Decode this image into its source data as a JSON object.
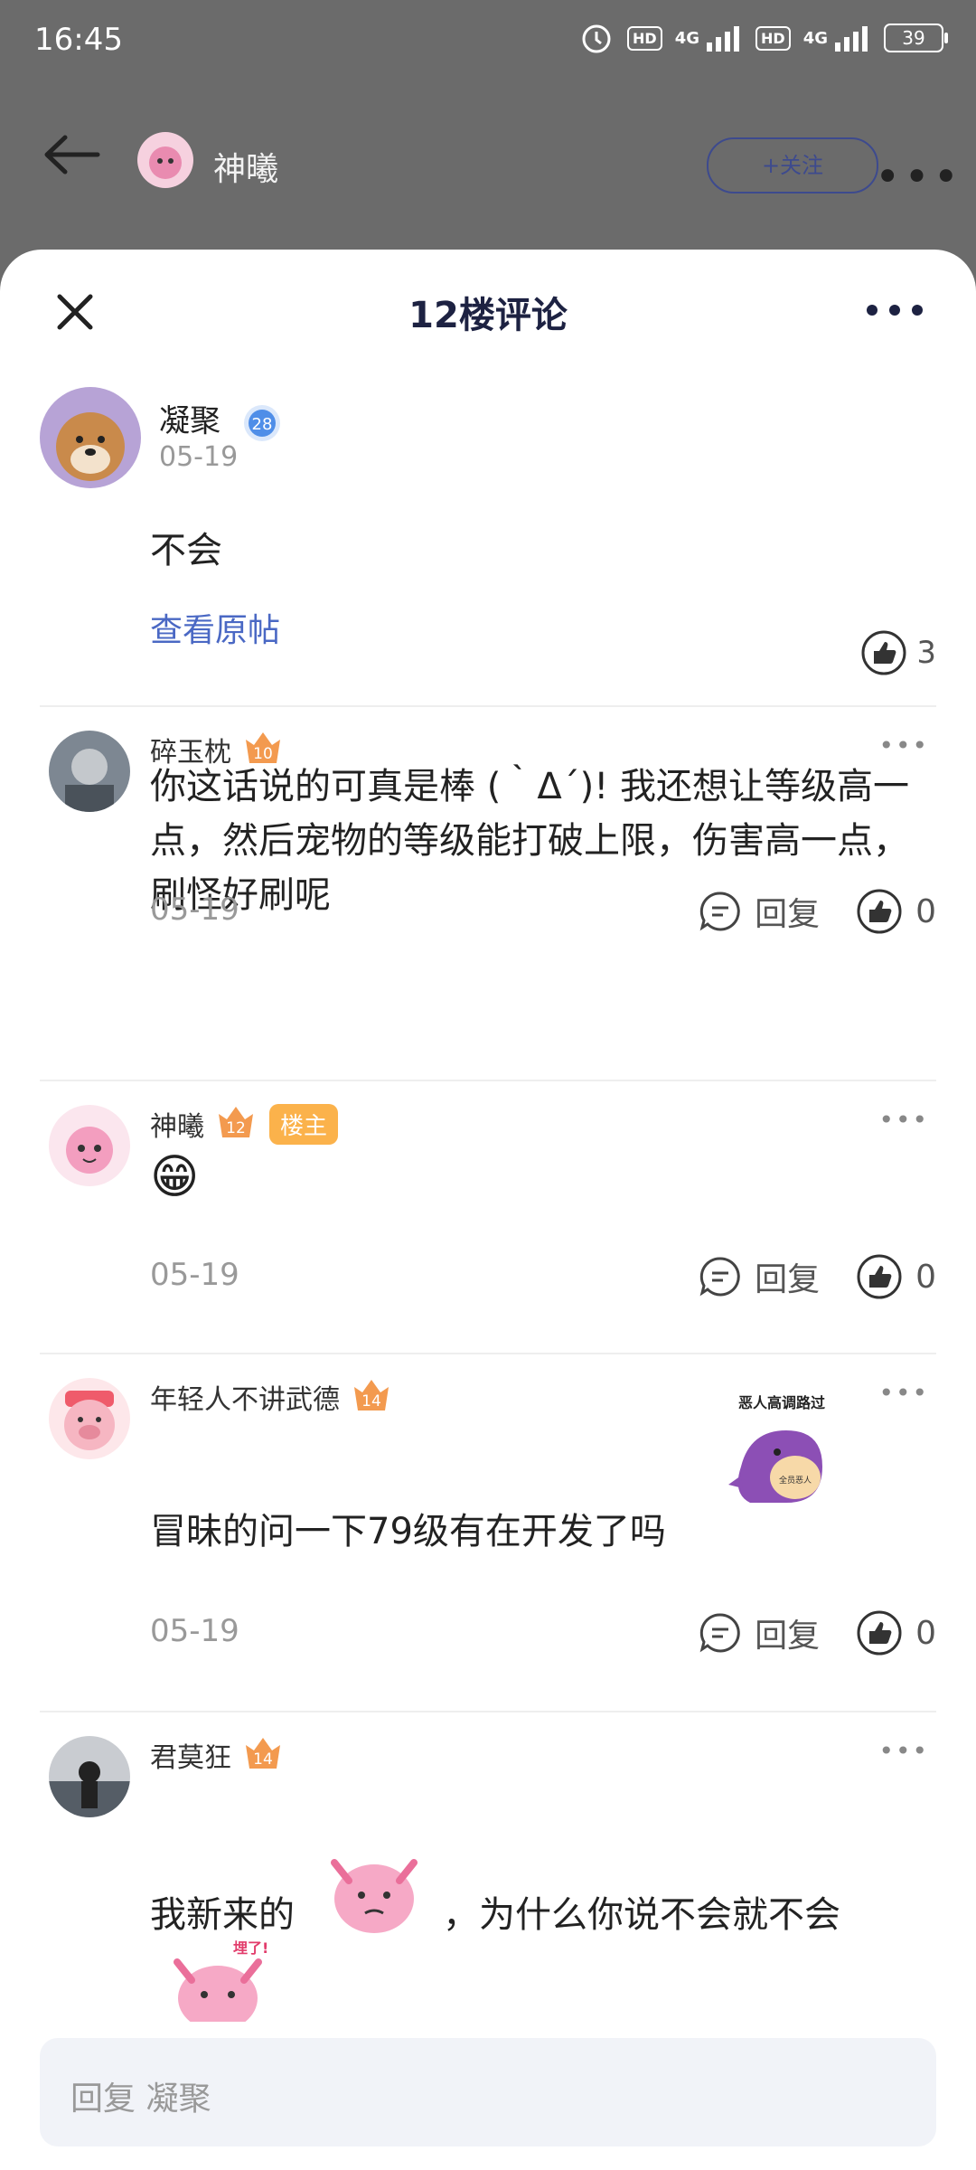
{
  "status": {
    "time": "16:45",
    "hd": "HD",
    "net": "4G",
    "battery": "39"
  },
  "topbar": {
    "name": "神曦",
    "follow": "+关注"
  },
  "sheet": {
    "title": "12楼评论"
  },
  "main_comment": {
    "user": "凝聚",
    "level": "28",
    "date": "05-19",
    "text": "不会",
    "view_post": "查看原帖",
    "likes": "3"
  },
  "replies": [
    {
      "user": "碎玉枕",
      "level": "10",
      "text": "你这话说的可真是棒 (｀Δ´)! 我还想让等级高一点，然后宠物的等级能打破上限，伤害高一点，刷怪好刷呢",
      "date": "05-19",
      "reply": "回复",
      "likes": "0"
    },
    {
      "user": "神曦",
      "level": "12",
      "badge": "楼主",
      "emoji": "😁",
      "date": "05-19",
      "reply": "回复",
      "likes": "0"
    },
    {
      "user": "年轻人不讲武德",
      "level": "14",
      "sticker": "恶人高调路过",
      "sticker_sub": "全员恶人",
      "text": "冒昧的问一下79级有在开发了吗",
      "date": "05-19",
      "reply": "回复",
      "likes": "0"
    },
    {
      "user": "君莫狂",
      "level": "14",
      "text_a": "我新来的",
      "text_b": "，为什么你说不会就不会",
      "sticker2": "埋了!"
    }
  ],
  "input": {
    "placeholder": "回复 凝聚"
  }
}
